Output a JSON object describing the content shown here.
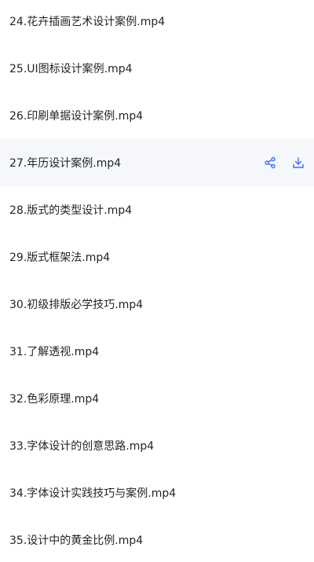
{
  "files": [
    {
      "name": "24.花卉插画艺术设计案例.mp4"
    },
    {
      "name": "25.UI图标设计案例.mp4"
    },
    {
      "name": "26.印刷单据设计案例.mp4"
    },
    {
      "name": "27.年历设计案例.mp4"
    },
    {
      "name": "28.版式的类型设计.mp4"
    },
    {
      "name": "29.版式框架法.mp4"
    },
    {
      "name": "30.初级排版必学技巧.mp4"
    },
    {
      "name": "31.了解透视.mp4"
    },
    {
      "name": "32.色彩原理.mp4"
    },
    {
      "name": "33.字体设计的创意思路.mp4"
    },
    {
      "name": "34.字体设计实践技巧与案例.mp4"
    },
    {
      "name": "35.设计中的黄金比例.mp4"
    }
  ],
  "hovered_row_actions": {
    "share_icon": "share-icon",
    "download_icon": "download-icon"
  },
  "colors": {
    "text": "#1f2329",
    "hover_background": "#f5f7fa",
    "accent": "#3370ff"
  }
}
